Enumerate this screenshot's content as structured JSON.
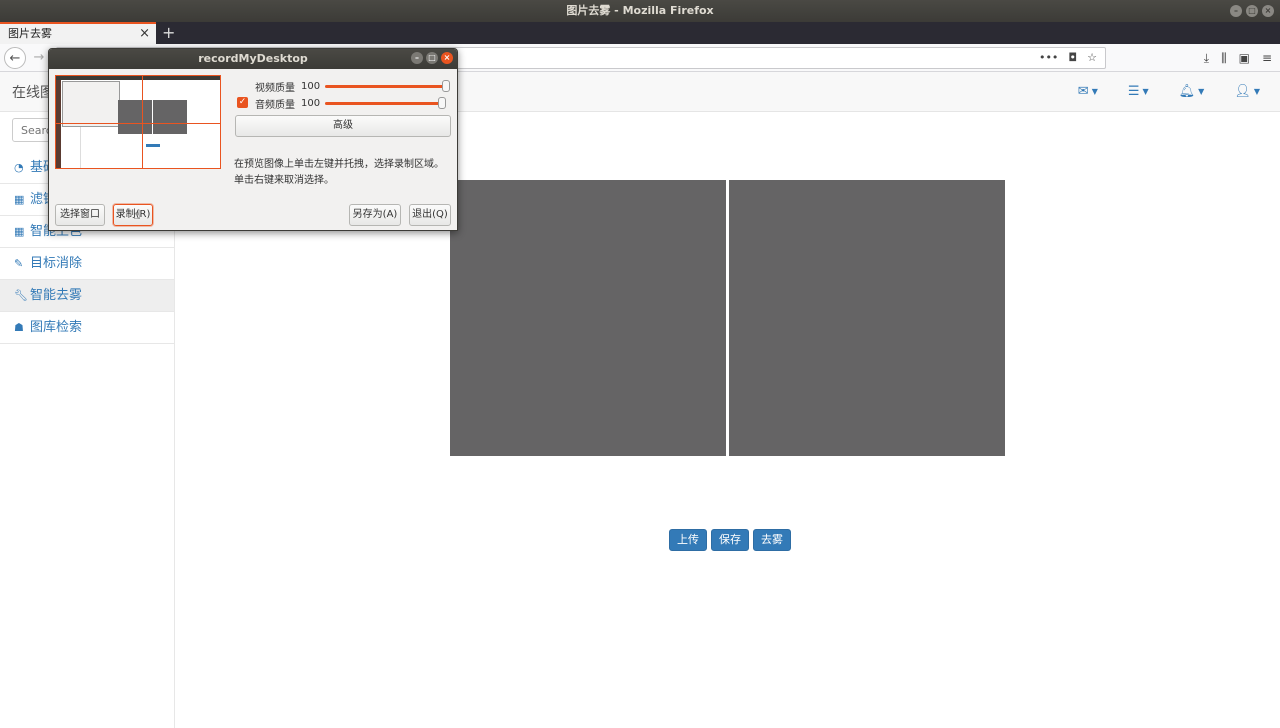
{
  "os": {
    "window_title": "图片去雾 - Mozilla Firefox"
  },
  "browser": {
    "tab_title": "图片去雾",
    "tab_close": "×",
    "new_tab": "+",
    "url": "",
    "page_actions": "•••",
    "right_icons": [
      "download-icon",
      "library-icon",
      "sidebar-icon",
      "menu-icon"
    ]
  },
  "app": {
    "brand": "在线图",
    "search_placeholder": "Search...",
    "menu": [
      {
        "label": "基础",
        "icon": "dashboard-icon"
      },
      {
        "label": "滤镜",
        "icon": "table-icon"
      },
      {
        "label": "智能上色",
        "icon": "table-icon"
      },
      {
        "label": "目标消除",
        "icon": "edit-icon"
      },
      {
        "label": "智能去雾",
        "icon": "wrench-icon",
        "active": true
      },
      {
        "label": "图库检索",
        "icon": "sitemap-icon"
      }
    ],
    "buttons": {
      "upload": "上传",
      "save": "保存",
      "dehaze": "去雾"
    }
  },
  "dialog": {
    "title": "recordMyDesktop",
    "video_quality_label": "视频质量",
    "video_quality_value": "100",
    "audio_quality_label": "音频质量",
    "audio_quality_value": "100",
    "audio_enabled": true,
    "advanced_button": "高级",
    "hint_line1": "在预览图像上单击左键并托拽，选择录制区域。",
    "hint_line2": "单击右键来取消选择。",
    "select_window_button": "选择窗口",
    "record_button": "录制(R)",
    "save_as_button": "另存为(A)",
    "quit_button": "退出(Q)"
  },
  "colors": {
    "accent": "#e95420",
    "link": "#337ab7",
    "placeholder": "#656465"
  }
}
